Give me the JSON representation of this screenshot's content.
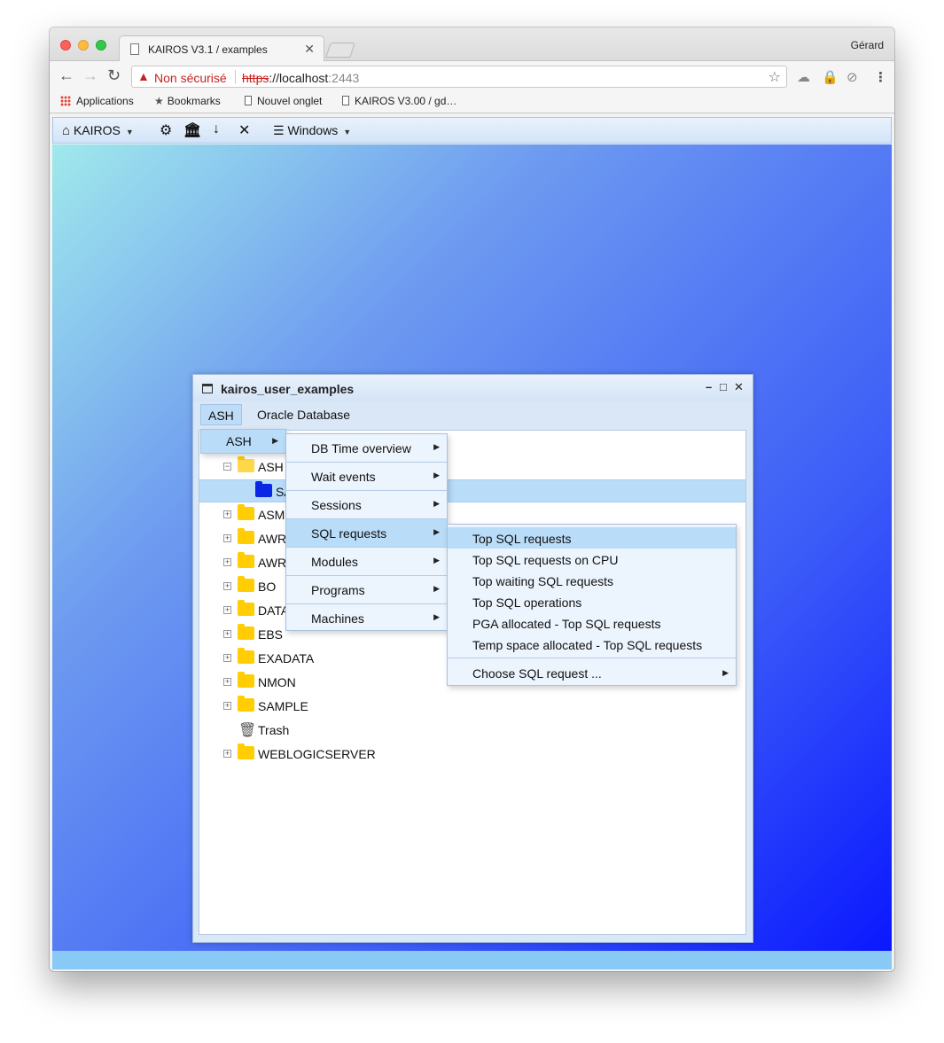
{
  "browser": {
    "tab_title": "KAIROS V3.1 / examples",
    "tab_close": "✕",
    "user": "Gérard",
    "security_label": "Non sécurisé",
    "url_scheme": "https",
    "url_sep": "://",
    "url_host": "localhost",
    "url_port": ":2443",
    "bookmarks": [
      "Applications",
      "Bookmarks",
      "Nouvel onglet",
      "KAIROS V3.00 / gd…"
    ]
  },
  "toolbar": {
    "app_name": "KAIROS",
    "windows_label": "Windows"
  },
  "window": {
    "title": "kairos_user_examples",
    "menus": [
      "ASH",
      "Oracle Database"
    ]
  },
  "tree": {
    "items": [
      {
        "label": "ASH",
        "state": "expanded"
      },
      {
        "label": "SA",
        "state": "selected"
      },
      {
        "label": "ASM"
      },
      {
        "label": "AWR"
      },
      {
        "label": "AWR"
      },
      {
        "label": "BO"
      },
      {
        "label": "DATA"
      },
      {
        "label": "EBS"
      },
      {
        "label": "EXADATA"
      },
      {
        "label": "NMON"
      },
      {
        "label": "SAMPLE"
      },
      {
        "label": "Trash"
      },
      {
        "label": "WEBLOGICSERVER"
      }
    ]
  },
  "menu_l1": {
    "items": [
      "ASH"
    ]
  },
  "menu_l2": {
    "items": [
      "DB Time overview",
      "Wait events",
      "Sessions",
      "SQL requests",
      "Modules",
      "Programs",
      "Machines"
    ],
    "active": "SQL requests"
  },
  "menu_l3": {
    "items": [
      "Top SQL requests",
      "Top SQL requests on CPU",
      "Top waiting SQL requests",
      "Top SQL operations",
      "PGA allocated - Top SQL requests",
      "Temp space allocated - Top SQL requests",
      "Choose SQL request ..."
    ],
    "active": "Top SQL requests"
  },
  "colors": {
    "desktop_gradient_start": "#a0e9ec",
    "desktop_gradient_end": "#0a18ff",
    "menu_highlight": "#b9dcf8",
    "folder_yellow": "#ffcd02",
    "folder_selected": "#0a27e6"
  }
}
